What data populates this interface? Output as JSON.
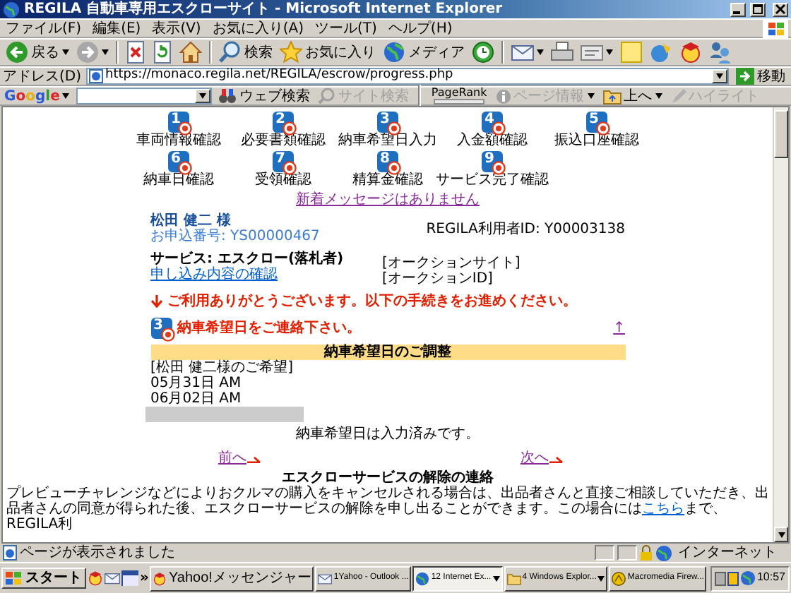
{
  "window": {
    "title": "REGILA  自動車専用エスクローサイト - Microsoft Internet Explorer"
  },
  "menu": [
    "ファイル(F)",
    "編集(E)",
    "表示(V)",
    "お気に入り(A)",
    "ツール(T)",
    "ヘルプ(H)"
  ],
  "toolbar": [
    [
      {
        "kind": "back",
        "label": "戻る",
        "dropdown": true
      },
      {
        "kind": "forward",
        "dropdown": true
      }
    ],
    [
      {
        "kind": "stop",
        "dropdown": false
      },
      {
        "kind": "refresh",
        "dropdown": false
      },
      {
        "kind": "home",
        "dropdown": false
      }
    ],
    [
      {
        "kind": "search",
        "label": "検索",
        "dropdown": false
      },
      {
        "kind": "favorites",
        "label": "お気に入り",
        "dropdown": false
      },
      {
        "kind": "media",
        "label": "メディア",
        "dropdown": false
      },
      {
        "kind": "history",
        "dropdown": false
      }
    ],
    [
      {
        "kind": "mail",
        "dropdown": true
      },
      {
        "kind": "print",
        "dropdown": false
      },
      {
        "kind": "edit",
        "dropdown": true
      },
      {
        "kind": "note",
        "dropdown": false
      },
      {
        "kind": "messenger",
        "dropdown": false
      },
      {
        "kind": "emblem",
        "dropdown": false
      },
      {
        "kind": "people",
        "dropdown": false
      }
    ]
  ],
  "address": {
    "label": "アドレス(D)",
    "url": "https://monaco.regila.net/REGILA/escrow/progress.php",
    "go": "移動"
  },
  "google": {
    "logo": "Google",
    "items": [
      {
        "kind": "web",
        "label": "ウェブ検索",
        "disabled": false
      },
      {
        "kind": "site",
        "label": "サイト検索",
        "disabled": true
      },
      {
        "kind": "pagerank",
        "label": "PageRank",
        "disabled": false
      },
      {
        "kind": "info",
        "label": "ページ情報",
        "disabled": true
      },
      {
        "kind": "up",
        "label": "上へ",
        "disabled": false
      },
      {
        "kind": "highlight",
        "label": "ハイライト",
        "disabled": true
      }
    ]
  },
  "page": {
    "steps": [
      {
        "number": "1",
        "label": "車両情報確認",
        "done": true
      },
      {
        "number": "2",
        "label": "必要書類確認",
        "done": true
      },
      {
        "number": "3",
        "label": "納車希望日入力",
        "done": true
      },
      {
        "number": "4",
        "label": "入金額確認",
        "done": true
      },
      {
        "number": "5",
        "label": "振込口座確認",
        "done": true
      },
      {
        "number": "6",
        "label": "納車日確認",
        "done": true
      },
      {
        "number": "7",
        "label": "受領確認",
        "done": true
      },
      {
        "number": "8",
        "label": "精算金確認",
        "done": true
      },
      {
        "number": "9",
        "label": "サービス完了確認",
        "done": true
      }
    ],
    "new_message": "新着メッセージはありません",
    "customer_name": "松田 健二 様",
    "application_no": "お申込番号: YS00000467",
    "user_id": "REGILA利用者ID: Y00003138",
    "service": "サービス: エスクロー(落札者)",
    "confirm_link": "申し込み内容の確認",
    "auction_site": "[オークションサイト]",
    "auction_id": "[オークションID]",
    "notice": "ご利用ありがとうございます。以下の手続きをお進めください。",
    "current_step": {
      "number": "3",
      "done": true,
      "title": "納車希望日をご連絡下さい。",
      "top_link": "↑"
    },
    "schedule": {
      "heading": "納車希望日のご調整",
      "lines": [
        "[松田 健二様のご希望]",
        "05月31日 AM",
        "06月02日 AM"
      ]
    },
    "done_message": "納車希望日は入力済みです。",
    "prev": "前へ",
    "next": "次へ",
    "cancel": {
      "heading": "エスクローサービスの解除の連絡",
      "text": "プレビューチャレンジなどによりおクルマの購入をキャンセルされる場合は、出品者さんと直接ご相談していただき、出品者さんの同意が得られた後、エスクローサービスの解除を申し出ることができます。この場合には",
      "link": "こちら",
      "text_after": "まで、REGILA利"
    }
  },
  "status_bar": {
    "text": "ページが表示されました",
    "zone": "インターネット"
  },
  "taskbar": {
    "start": "スタート",
    "more": "»",
    "tasks": [
      {
        "label": "Yahoo!メッセンジャー",
        "selected": false,
        "grouped": false
      },
      {
        "label": "1Yahoo - Outlook ...",
        "selected": false,
        "grouped": false
      },
      {
        "label": "12 Internet Ex...",
        "selected": true,
        "grouped": true
      },
      {
        "label": "4 Windows Explor...",
        "selected": false,
        "grouped": true
      },
      {
        "label": "Macromedia Firew...",
        "selected": false,
        "grouped": false
      }
    ],
    "clock": "10:57"
  }
}
